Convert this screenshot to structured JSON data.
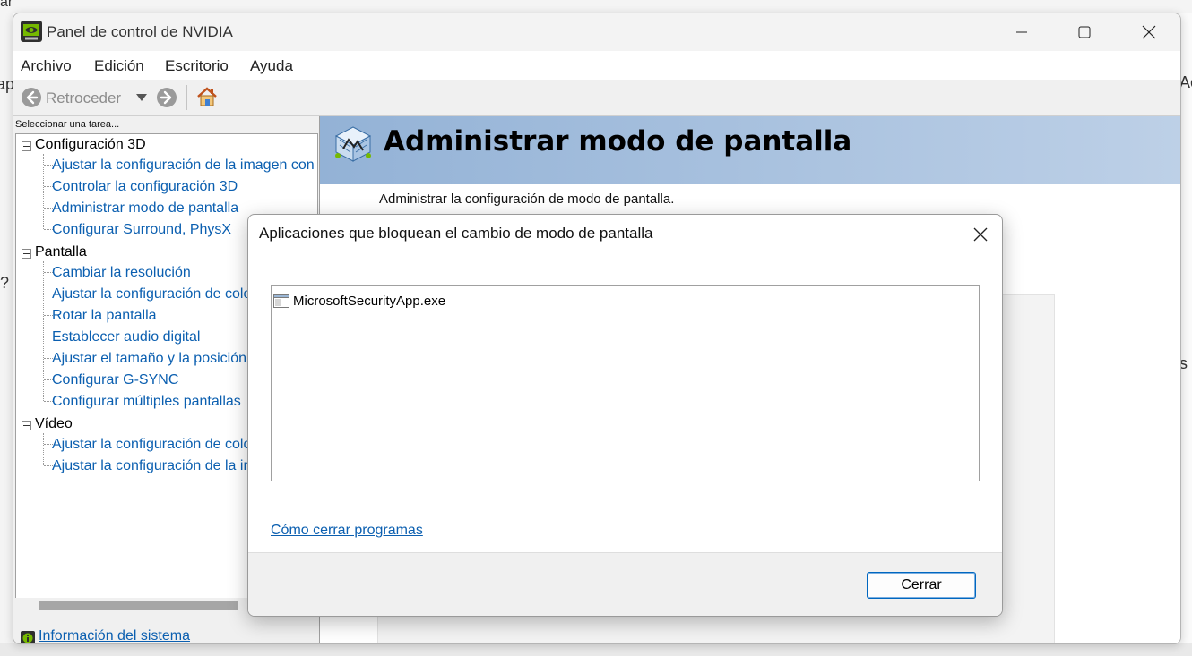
{
  "background": {
    "fragment_left_top": "ap",
    "fragment_left_mid": "?",
    "fragment_right_top": "Ac",
    "fragment_right_mid": "s",
    "fragment_top": "ar"
  },
  "window": {
    "title": "Panel de control de NVIDIA"
  },
  "menu": {
    "items": [
      "Archivo",
      "Edición",
      "Escritorio",
      "Ayuda"
    ]
  },
  "toolbar": {
    "back_label": "Retroceder"
  },
  "left_panel": {
    "task_label": "Seleccionar una tarea...",
    "tree": [
      {
        "label": "Configuración 3D",
        "children": [
          "Ajustar la configuración de la imagen con",
          "Controlar la configuración 3D",
          "Administrar modo de pantalla",
          "Configurar Surround, PhysX"
        ]
      },
      {
        "label": "Pantalla",
        "children": [
          "Cambiar la resolución",
          "Ajustar la configuración de colo",
          "Rotar la pantalla",
          "Establecer audio digital",
          "Ajustar el tamaño y la posición",
          "Configurar G-SYNC",
          "Configurar múltiples pantallas"
        ]
      },
      {
        "label": "Vídeo",
        "children": [
          "Ajustar la configuración de colo",
          "Ajustar la configuración de la in"
        ]
      }
    ],
    "system_info_link": "Información del sistema"
  },
  "right_panel": {
    "title": "Administrar modo de pantalla",
    "description": "Administrar la configuración de modo de pantalla."
  },
  "dialog": {
    "title": "Aplicaciones que bloquean el cambio de modo de pantalla",
    "list_items": [
      "MicrosoftSecurityApp.exe"
    ],
    "help_link": "Cómo cerrar programas",
    "close_button": "Cerrar"
  }
}
